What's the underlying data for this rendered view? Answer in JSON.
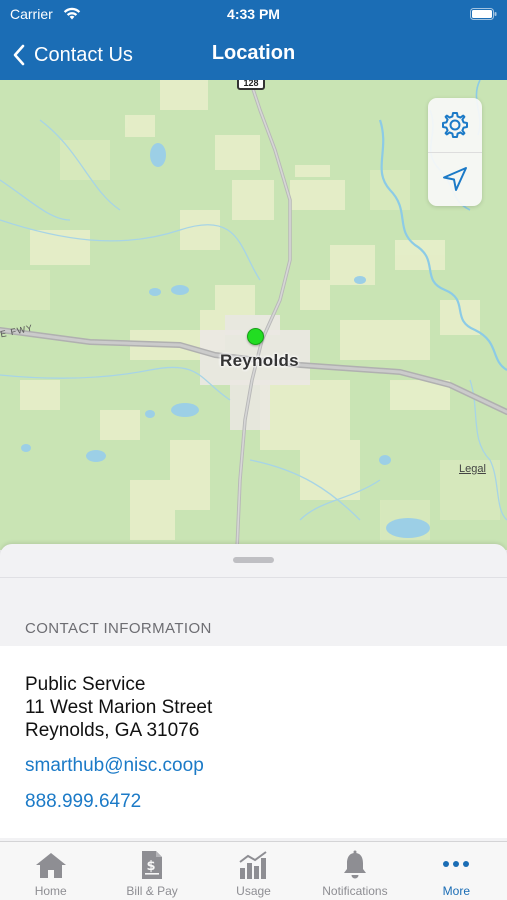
{
  "status_bar": {
    "carrier": "Carrier",
    "time": "4:33 PM"
  },
  "nav": {
    "back_label": "Contact Us",
    "title": "Location"
  },
  "map": {
    "town_label": "Reynolds",
    "road_shield": "128",
    "highway_label": "E FWY",
    "legal": "Legal",
    "controls": [
      "gear-icon",
      "location-arrow-icon"
    ],
    "pin_color": "#22dd22"
  },
  "contact": {
    "section_header": "CONTACT INFORMATION",
    "name": "Public Service",
    "street": "11 West Marion Street",
    "city_state_zip": "Reynolds, GA 31076",
    "email": "smarthub@nisc.coop",
    "phone": "888.999.6472"
  },
  "tabs": [
    {
      "label": "Home",
      "icon": "home-icon"
    },
    {
      "label": "Bill & Pay",
      "icon": "bill-icon"
    },
    {
      "label": "Usage",
      "icon": "usage-chart-icon"
    },
    {
      "label": "Notifications",
      "icon": "bell-icon"
    },
    {
      "label": "More",
      "icon": "more-dots-icon",
      "active": true
    }
  ],
  "colors": {
    "brand": "#1b6db5",
    "link": "#1b7ac7",
    "inactive_tab": "#8e8e93"
  }
}
